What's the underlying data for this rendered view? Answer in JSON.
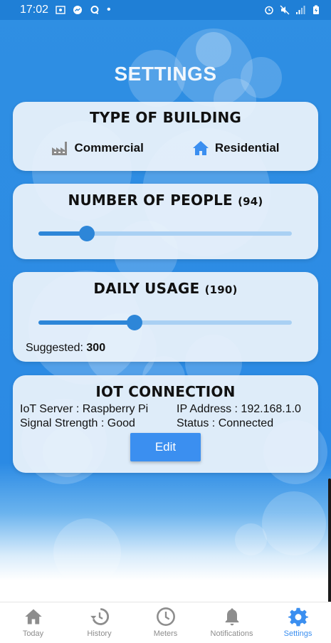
{
  "status_bar": {
    "time": "17:02",
    "dot": "•"
  },
  "title": "SETTINGS",
  "building": {
    "title": "TYPE OF BUILDING",
    "options": [
      {
        "label": "Commercial",
        "icon": "factory-icon",
        "selected": false
      },
      {
        "label": "Residential",
        "icon": "home-icon",
        "selected": true
      }
    ]
  },
  "people": {
    "title": "NUMBER OF PEOPLE",
    "value": "(94)",
    "slider_fraction": 0.19
  },
  "usage": {
    "title": "DAILY USAGE",
    "value": "(190)",
    "slider_fraction": 0.38,
    "suggested_label": "Suggested:",
    "suggested_value": "300"
  },
  "iot": {
    "title": "IOT CONNECTION",
    "server": "IoT Server : Raspberry Pi",
    "ip": "IP Address : 192.168.1.0",
    "signal": "Signal Strength : Good",
    "status": "Status : Connected",
    "edit_label": "Edit"
  },
  "nav": {
    "items": [
      {
        "label": "Today",
        "icon": "home-icon"
      },
      {
        "label": "History",
        "icon": "history-icon"
      },
      {
        "label": "Meters",
        "icon": "clock-icon"
      },
      {
        "label": "Notifications",
        "icon": "bell-icon"
      },
      {
        "label": "Settings",
        "icon": "gear-icon"
      }
    ],
    "active": "Settings"
  },
  "colors": {
    "accent": "#3b8ff0",
    "background": "#2b8ae4",
    "slider_track": "#a9d0f3",
    "slider_fill": "#2d86d8",
    "inactive_nav": "#8d8d8d"
  }
}
